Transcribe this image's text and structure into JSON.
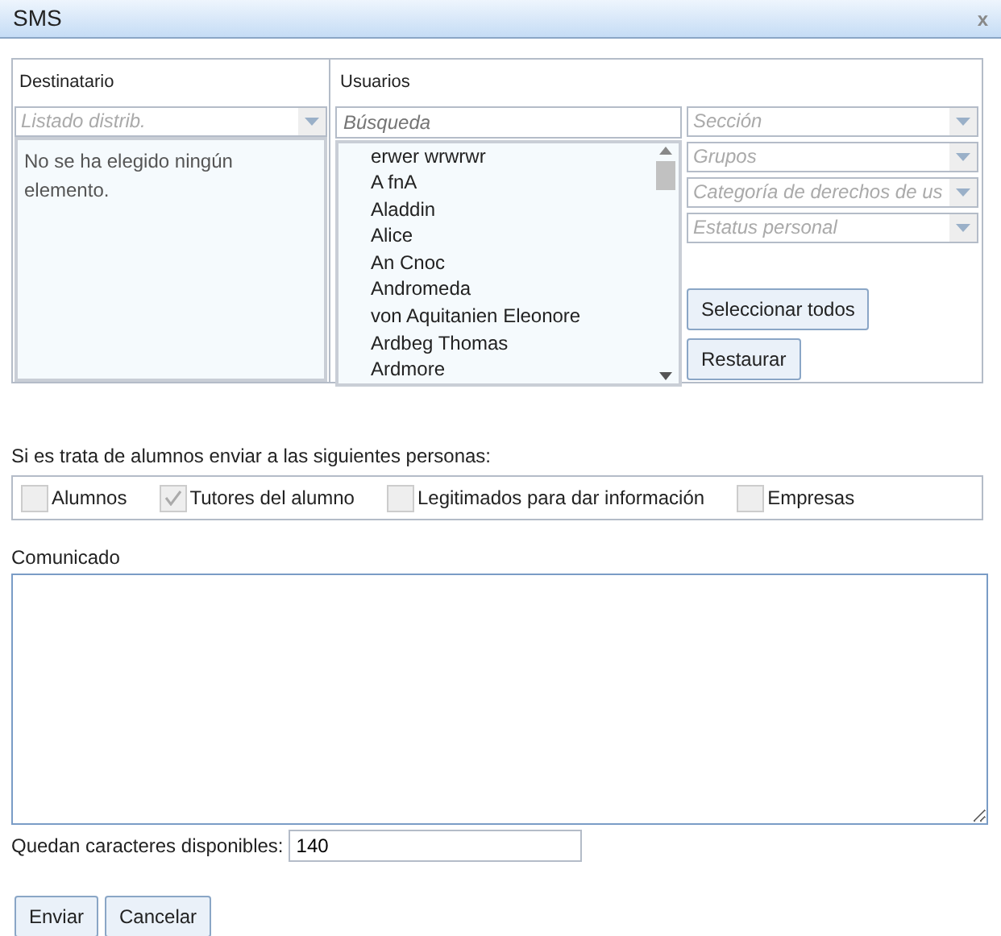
{
  "window": {
    "title": "SMS",
    "close": "x"
  },
  "recipient": {
    "label": "Destinatario",
    "distribution_list": {
      "placeholder": "Listado distrib."
    },
    "empty_text": "No se ha elegido ningún elemento."
  },
  "users": {
    "label": "Usuarios",
    "search": {
      "placeholder": "Búsqueda"
    },
    "items": [
      "erwer wrwrwr",
      "A fnA",
      "Aladdin",
      "Alice",
      "An Cnoc",
      "Andromeda",
      "von Aquitanien Eleonore",
      "Ardbeg Thomas",
      "Ardmore"
    ],
    "filters": [
      {
        "placeholder": "Sección"
      },
      {
        "placeholder": "Grupos"
      },
      {
        "placeholder": "Categoría de derechos de us"
      },
      {
        "placeholder": "Estatus personal"
      }
    ],
    "buttons": [
      "Seleccionar todos",
      "Restaurar"
    ]
  },
  "students": {
    "label": "Si es trata de alumnos enviar a las siguientes personas:",
    "options": [
      {
        "label": "Alumnos",
        "checked": false
      },
      {
        "label": "Tutores del alumno",
        "checked": true
      },
      {
        "label": "Legitimados para dar información",
        "checked": false
      },
      {
        "label": "Empresas",
        "checked": false
      }
    ]
  },
  "message": {
    "label": "Comunicado"
  },
  "remaining": {
    "label": "Quedan caracteres disponibles:",
    "value": "140"
  },
  "buttons": [
    "Enviar",
    "Cancelar"
  ]
}
